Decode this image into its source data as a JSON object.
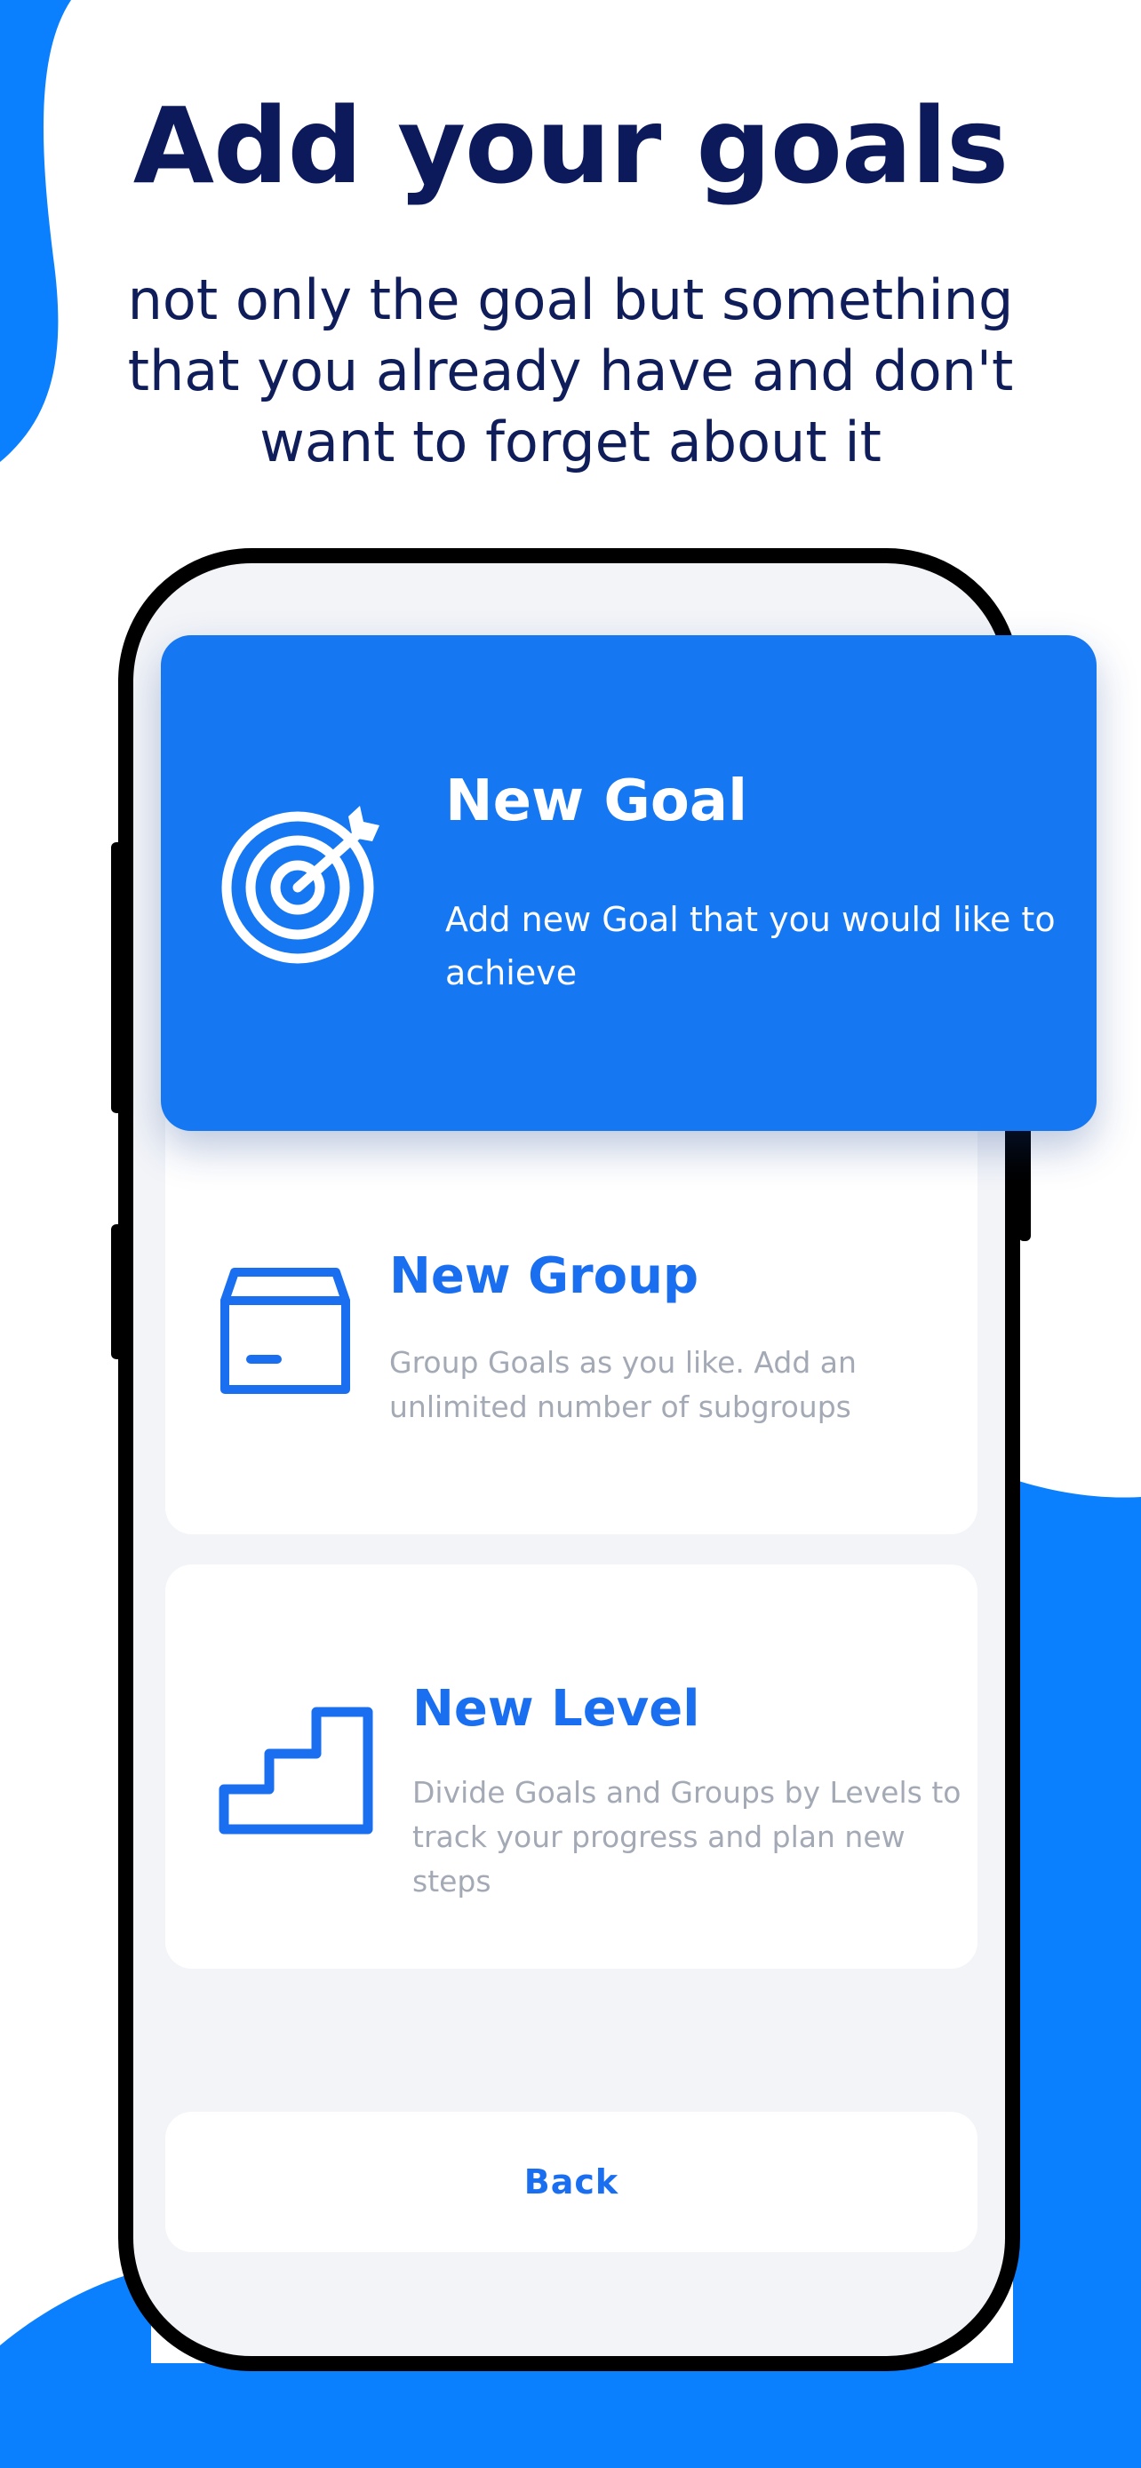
{
  "headline": "Add your goals",
  "subtitle_lines": [
    "not only the goal but something",
    "that you already have and don't",
    "want to forget about it"
  ],
  "colors": {
    "brand_blue": "#0a80ff",
    "card_blue": "#1577f2",
    "headline": "#0c1a5c",
    "accent_text": "#1a6ff0",
    "muted_text": "#a3a9b5"
  },
  "cards": {
    "goal": {
      "title": "New Goal",
      "description": "Add new Goal that you would like to achieve",
      "icon": "target-icon"
    },
    "group": {
      "title": "New Group",
      "description_lines": [
        "Group Goals as you like. Add an",
        "unlimited number of subgroups"
      ],
      "icon": "box-icon"
    },
    "level": {
      "title": "New Level",
      "description_lines": [
        "Divide Goals and Groups by Levels to",
        "track your progress and plan new steps"
      ],
      "icon": "stairs-icon"
    }
  },
  "back_button": {
    "label": "Back"
  }
}
